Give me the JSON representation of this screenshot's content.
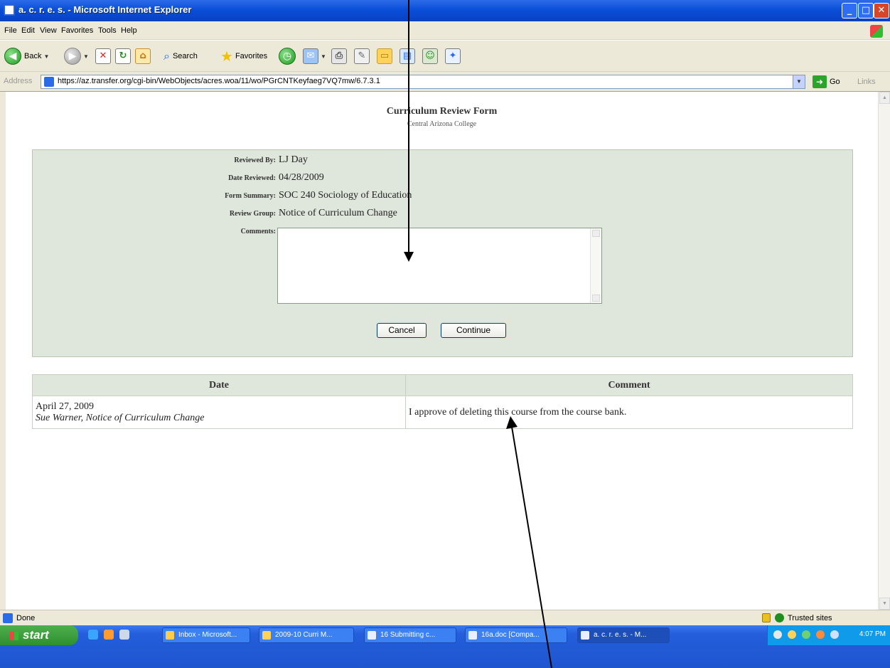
{
  "window": {
    "title": "a. c. r. e. s. - Microsoft Internet Explorer",
    "min_glyph": "_",
    "max_glyph": "□",
    "close_glyph": "✕"
  },
  "menu": [
    "File",
    "Edit",
    "View",
    "Favorites",
    "Tools",
    "Help"
  ],
  "toolbar": {
    "back_label": "Back",
    "search_label": "Search",
    "favorites_label": "Favorites"
  },
  "address": {
    "label": "Address",
    "url": "https://az.transfer.org/cgi-bin/WebObjects/acres.woa/11/wo/PGrCNTKeyfaeg7VQ7mw/6.7.3.1",
    "go_label": "Go",
    "links_label": "Links"
  },
  "page": {
    "title": "Curriculum Review Form",
    "subtitle": "Central Arizona College"
  },
  "form": {
    "reviewed_by_label": "Reviewed By:",
    "reviewed_by": "LJ Day",
    "date_reviewed_label": "Date Reviewed:",
    "date_reviewed": "04/28/2009",
    "form_summary_label": "Form Summary:",
    "form_summary": "SOC 240 Sociology of Education",
    "review_group_label": "Review Group:",
    "review_group": "Notice of Curriculum Change",
    "comments_label": "Comments:",
    "comments_value": "",
    "cancel_label": "Cancel",
    "continue_label": "Continue"
  },
  "history": {
    "headers": [
      "Date",
      "Comment"
    ],
    "rows": [
      {
        "date": "April 27, 2009",
        "reviewer": "Sue Warner, Notice of Curriculum Change",
        "comment": "I approve of deleting this course from the course bank."
      }
    ]
  },
  "status": {
    "text": "Done",
    "zone": "Trusted sites"
  },
  "taskbar": {
    "start_label": "start",
    "tasks": [
      "Inbox - Microsoft...",
      "2009-10 Curri M...",
      "16 Submitting c...",
      "16a.doc [Compa...",
      "a. c. r. e. s. - M..."
    ],
    "clock": "4:07 PM"
  },
  "colors": {
    "panel_bg": "#dfe6dc",
    "title_bar": "#0a4fd8",
    "taskbar": "#245edb"
  }
}
